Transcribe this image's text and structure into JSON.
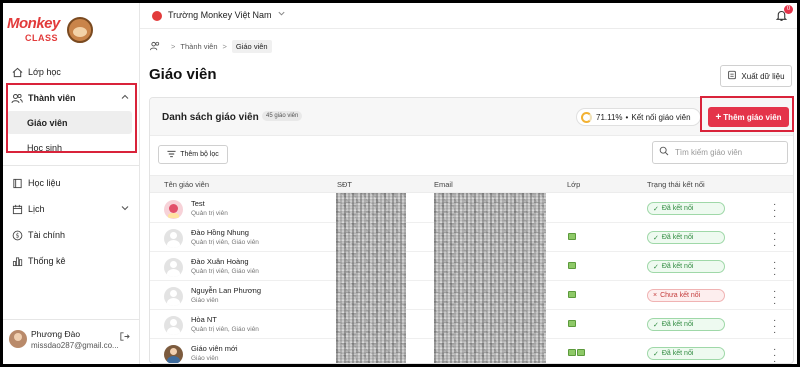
{
  "brand": {
    "logo_word": "Monkey",
    "logo_sub": "CLASS"
  },
  "sidebar": {
    "items": [
      {
        "label": "Lớp học",
        "icon": "home-icon"
      },
      {
        "label": "Thành viên",
        "icon": "users-icon",
        "expanded": true,
        "children": [
          {
            "label": "Giáo viên",
            "active": true
          },
          {
            "label": "Học sinh"
          }
        ]
      },
      {
        "label": "Học liệu",
        "icon": "book-icon"
      },
      {
        "label": "Lịch",
        "icon": "calendar-icon"
      },
      {
        "label": "Tài chính",
        "icon": "dollar-icon"
      },
      {
        "label": "Thống kê",
        "icon": "bar-chart-icon"
      }
    ],
    "profile": {
      "name": "Phương Đào",
      "email": "missdao287@gmail.co..."
    }
  },
  "topbar": {
    "school": "Trường Monkey Việt Nam",
    "notification_count": "0"
  },
  "breadcrumb": {
    "parent": "Thành viên",
    "current": "Giáo viên"
  },
  "page": {
    "title": "Giáo viên",
    "export_label": "Xuất dữ liệu"
  },
  "card": {
    "title": "Danh sách giáo viên",
    "count_badge": "45 giáo viên",
    "connect_pct": "71.11%",
    "connect_label": "Kết nối giáo viên",
    "add_label": "Thêm giáo viên",
    "filter_label": "Thêm bộ lọc",
    "search_placeholder": "Tìm kiếm giáo viên"
  },
  "table": {
    "headers": {
      "name": "Tên giáo viên",
      "phone": "SĐT",
      "email": "Email",
      "class": "Lớp",
      "status": "Trạng thái kết nối"
    },
    "rows": [
      {
        "name": "Test",
        "role": "Quản trị viên",
        "classes": 0,
        "status": "Đã kết nối",
        "connected": true
      },
      {
        "name": "Đào Hồng Nhung",
        "role": "Quản trị viên, Giáo viên",
        "classes": 1,
        "status": "Đã kết nối",
        "connected": true
      },
      {
        "name": "Đào Xuân Hoàng",
        "role": "Quản trị viên, Giáo viên",
        "classes": 1,
        "status": "Đã kết nối",
        "connected": true
      },
      {
        "name": "Nguyễn Lan Phương",
        "role": "Giáo viên",
        "classes": 1,
        "status": "Chưa kết nối",
        "connected": false
      },
      {
        "name": "Hòa NT",
        "role": "Quản trị viên, Giáo viên",
        "classes": 1,
        "status": "Đã kết nối",
        "connected": true
      },
      {
        "name": "Giáo viên mới",
        "role": "Giáo viên",
        "classes": 2,
        "status": "Đã kết nối",
        "connected": true
      }
    ]
  },
  "colors": {
    "accent": "#e4344a",
    "highlight": "#d9233a",
    "success": "#2f8a3f"
  }
}
